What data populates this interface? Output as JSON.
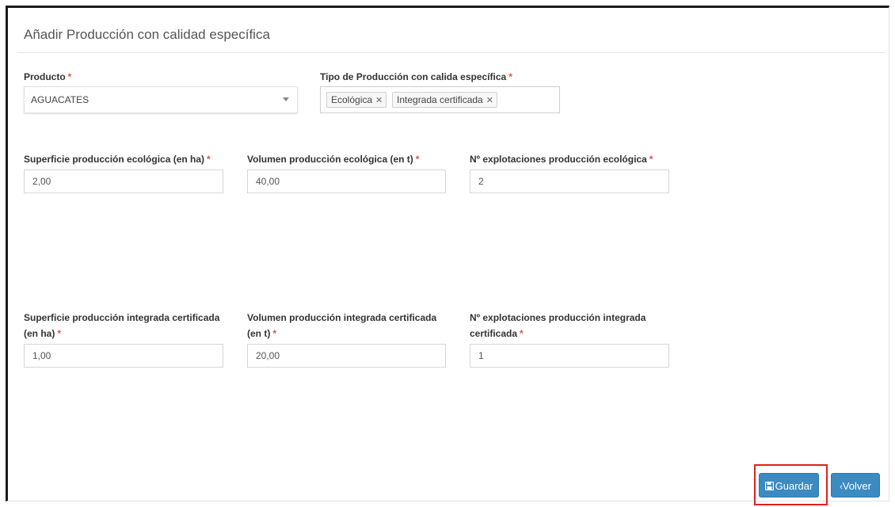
{
  "page": {
    "title": "Añadir Producción con calidad específica"
  },
  "producto": {
    "label": "Producto",
    "value": "AGUACATES"
  },
  "tipo": {
    "label": "Tipo de Producción con calida específica",
    "tags": [
      "Ecológica",
      "Integrada certificada"
    ]
  },
  "ecologica": {
    "superficie_label": "Superficie producción ecológica (en ha)",
    "superficie_value": "2,00",
    "volumen_label": "Volumen producción ecológica (en t)",
    "volumen_value": "40,00",
    "explotaciones_label": "Nº explotaciones producción ecológica",
    "explotaciones_value": "2"
  },
  "integrada": {
    "superficie_label_1": "Superficie producción integrada certificada",
    "superficie_label_2": "(en ha)",
    "superficie_value": "1,00",
    "volumen_label_1": "Volumen producción integrada certificada",
    "volumen_label_2": "(en t)",
    "volumen_value": "20,00",
    "explotaciones_label_1": "Nº explotaciones producción integrada",
    "explotaciones_label_2": "certificada",
    "explotaciones_value": "1"
  },
  "required_mark": "*",
  "buttons": {
    "save_label": "Guardar",
    "back_label": "Volver"
  },
  "colors": {
    "primary": "#3b8bc2",
    "required": "#d9534f",
    "highlight": "#e02020"
  }
}
